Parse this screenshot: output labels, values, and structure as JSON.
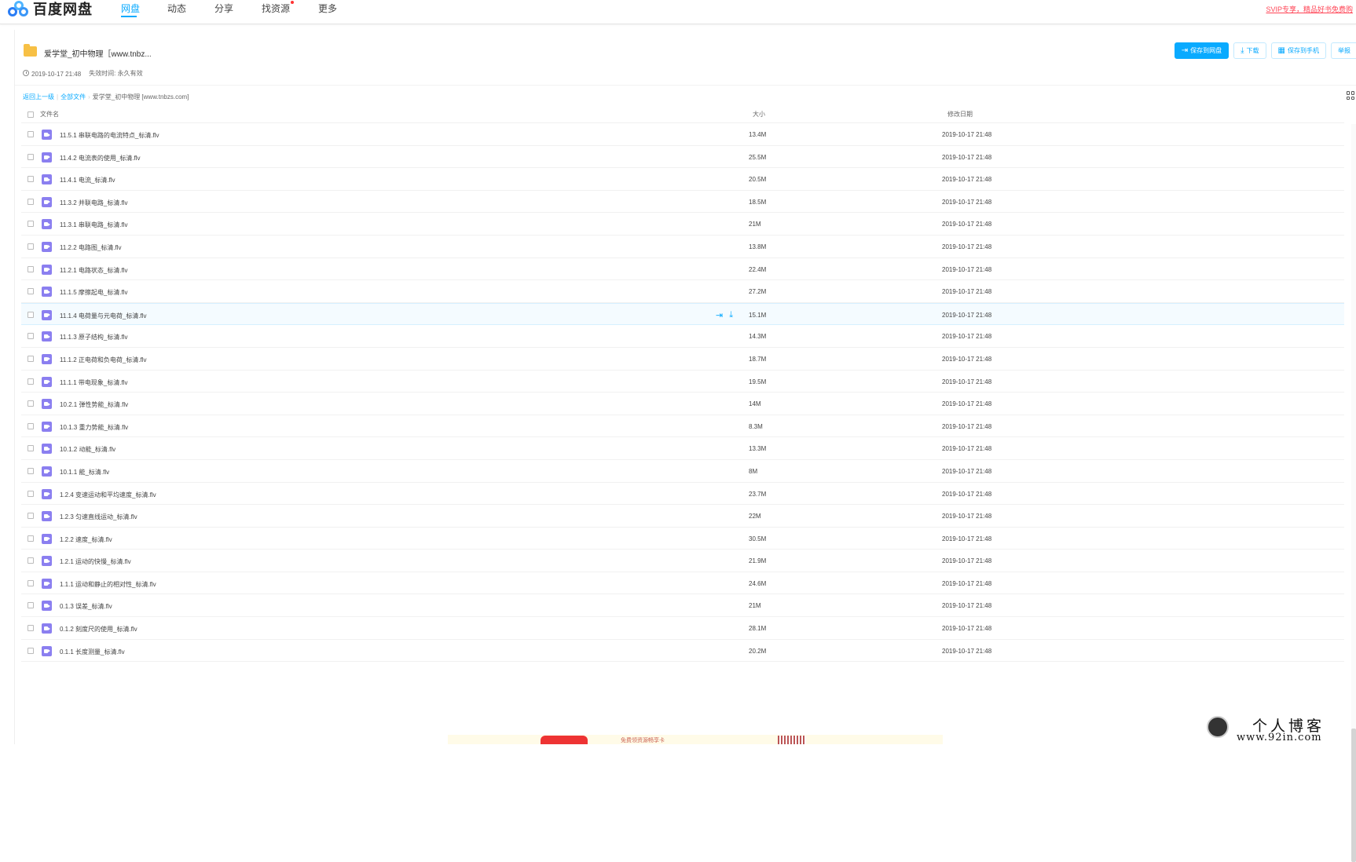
{
  "nav": {
    "logo_text": "百度网盘",
    "items": [
      "网盘",
      "动态",
      "分享",
      "找资源",
      "更多"
    ],
    "svip": "SVIP专享，精品好书免费购"
  },
  "share": {
    "title": "爱学堂_初中物理［www.tnbz...",
    "created": "2019-10-17 21:48",
    "expiry_label": "失效时间:",
    "expiry_value": "永久有效",
    "buttons": {
      "save": "保存到网盘",
      "download": "下载",
      "save_phone": "保存到手机",
      "report": "举报"
    }
  },
  "breadcrumb": {
    "back": "返回上一级",
    "all": "全部文件",
    "current": "爱学堂_初中物理 [www.tnbzs.com]"
  },
  "columns": {
    "name": "文件名",
    "size": "大小",
    "date": "修改日期"
  },
  "files": [
    {
      "name": "11.5.1 串联电路的电流特点_标清.flv",
      "size": "13.4M",
      "date": "2019-10-17 21:48"
    },
    {
      "name": "11.4.2 电流表的使用_标清.flv",
      "size": "25.5M",
      "date": "2019-10-17 21:48"
    },
    {
      "name": "11.4.1 电流_标清.flv",
      "size": "20.5M",
      "date": "2019-10-17 21:48"
    },
    {
      "name": "11.3.2 并联电路_标清.flv",
      "size": "18.5M",
      "date": "2019-10-17 21:48"
    },
    {
      "name": "11.3.1 串联电路_标清.flv",
      "size": "21M",
      "date": "2019-10-17 21:48"
    },
    {
      "name": "11.2.2 电路图_标清.flv",
      "size": "13.8M",
      "date": "2019-10-17 21:48"
    },
    {
      "name": "11.2.1 电路状态_标清.flv",
      "size": "22.4M",
      "date": "2019-10-17 21:48"
    },
    {
      "name": "11.1.5 摩擦起电_标清.flv",
      "size": "27.2M",
      "date": "2019-10-17 21:48"
    },
    {
      "name": "11.1.4 电荷量与元电荷_标清.flv",
      "size": "15.1M",
      "date": "2019-10-17 21:48"
    },
    {
      "name": "11.1.3 原子结构_标清.flv",
      "size": "14.3M",
      "date": "2019-10-17 21:48"
    },
    {
      "name": "11.1.2 正电荷和负电荷_标清.flv",
      "size": "18.7M",
      "date": "2019-10-17 21:48"
    },
    {
      "name": "11.1.1 带电现象_标清.flv",
      "size": "19.5M",
      "date": "2019-10-17 21:48"
    },
    {
      "name": "10.2.1 弹性势能_标清.flv",
      "size": "14M",
      "date": "2019-10-17 21:48"
    },
    {
      "name": "10.1.3 重力势能_标清.flv",
      "size": "8.3M",
      "date": "2019-10-17 21:48"
    },
    {
      "name": "10.1.2 动能_标清.flv",
      "size": "13.3M",
      "date": "2019-10-17 21:48"
    },
    {
      "name": "10.1.1 能_标清.flv",
      "size": "8M",
      "date": "2019-10-17 21:48"
    },
    {
      "name": "1.2.4 变速运动和平均速度_标清.flv",
      "size": "23.7M",
      "date": "2019-10-17 21:48"
    },
    {
      "name": "1.2.3 匀速直线运动_标清.flv",
      "size": "22M",
      "date": "2019-10-17 21:48"
    },
    {
      "name": "1.2.2 速度_标清.flv",
      "size": "30.5M",
      "date": "2019-10-17 21:48"
    },
    {
      "name": "1.2.1 运动的快慢_标清.flv",
      "size": "21.9M",
      "date": "2019-10-17 21:48"
    },
    {
      "name": "1.1.1 运动和静止的相对性_标清.flv",
      "size": "24.6M",
      "date": "2019-10-17 21:48"
    },
    {
      "name": "0.1.3 误差_标清.flv",
      "size": "21M",
      "date": "2019-10-17 21:48"
    },
    {
      "name": "0.1.2 刻度尺的使用_标清.flv",
      "size": "28.1M",
      "date": "2019-10-17 21:48"
    },
    {
      "name": "0.1.1 长度测量_标清.flv",
      "size": "20.2M",
      "date": "2019-10-17 21:48"
    }
  ],
  "banner": {
    "text": "免费领资源畅享卡"
  },
  "watermark": {
    "line1": "个人博客",
    "line2": "www.92in.com"
  },
  "colors": {
    "accent": "#09aaff",
    "video_icon": "#8b7ff0",
    "folder": "#f7c045"
  }
}
